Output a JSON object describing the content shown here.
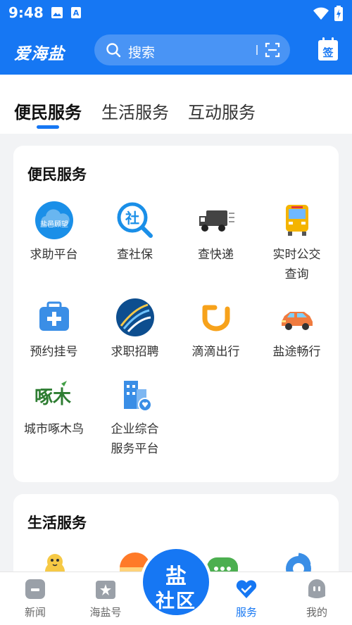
{
  "status_bar": {
    "time": "9:48"
  },
  "header": {
    "logo": "爱海盐",
    "search_placeholder": "搜索"
  },
  "tabs": [
    {
      "label": "便民服务"
    },
    {
      "label": "生活服务"
    },
    {
      "label": "互动服务"
    }
  ],
  "sections": [
    {
      "title": "便民服务",
      "items": [
        {
          "label": "求助平台",
          "icon": "cloud-help-icon",
          "icon_text": "盐邑顾望"
        },
        {
          "label": "查社保",
          "icon": "social-security-search-icon",
          "icon_text": "社"
        },
        {
          "label": "查快递",
          "icon": "delivery-truck-icon"
        },
        {
          "label": "实时公交查询",
          "icon": "bus-icon"
        },
        {
          "label": "预约挂号",
          "icon": "medical-kit-icon"
        },
        {
          "label": "求职招聘",
          "icon": "job-recruit-icon"
        },
        {
          "label": "滴滴出行",
          "icon": "didi-icon"
        },
        {
          "label": "盐途畅行",
          "icon": "car-icon"
        },
        {
          "label": "城市啄木鸟",
          "icon": "woodpecker-icon",
          "icon_text": "啄木"
        },
        {
          "label": "企业综合服务平台",
          "icon": "enterprise-building-icon"
        }
      ]
    },
    {
      "title": "生活服务",
      "items": [
        {
          "icon": "duck-icon"
        },
        {
          "icon": "sunset-icon"
        },
        {
          "icon": "chat-green-icon"
        },
        {
          "icon": "blue-swirl-icon"
        }
      ]
    }
  ],
  "bottom_nav": [
    {
      "label": "新闻",
      "icon": "news-icon"
    },
    {
      "label": "海盐号",
      "icon": "star-box-icon"
    },
    {
      "label": "服务",
      "icon": "heart-check-icon",
      "active": true
    },
    {
      "label": "我的",
      "icon": "profile-icon"
    }
  ],
  "center_button": {
    "line1": "盐",
    "line2": "社区"
  },
  "colors": {
    "primary": "#1677f3"
  }
}
